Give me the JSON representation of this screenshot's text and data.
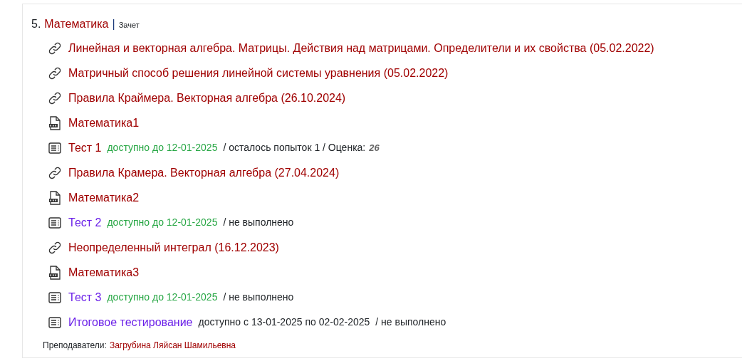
{
  "course": {
    "number": "5.",
    "title": "Математика",
    "separator": "|",
    "assessment": "Зачет"
  },
  "items": [
    {
      "kind": "link",
      "title": "Линейная и векторная алгебра. Матрицы. Действия над матрицами. Определители и их свойства (05.02.2022)",
      "visited": false
    },
    {
      "kind": "link",
      "title": "Матричный способ решения линейной системы уравнения (05.02.2022)",
      "visited": false
    },
    {
      "kind": "link",
      "title": "Правила Краймера. Векторная алгебра (26.10.2024)",
      "visited": false
    },
    {
      "kind": "pdf",
      "title": "Математика1",
      "visited": false
    },
    {
      "kind": "test",
      "title": "Тест 1",
      "visited": false,
      "availability": {
        "text": "доступно до 12-01-2025",
        "color": "#28a745"
      },
      "status": "/ осталось попыток 1 / Оценка:",
      "grade": "26"
    },
    {
      "kind": "link",
      "title": "Правила Крамера. Векторная алгебра (27.04.2024)",
      "visited": false
    },
    {
      "kind": "pdf",
      "title": "Математика2",
      "visited": false
    },
    {
      "kind": "test",
      "title": "Тест 2",
      "visited": true,
      "availability": {
        "text": "доступно до 12-01-2025",
        "color": "#28a745"
      },
      "status": "/ не выполнено"
    },
    {
      "kind": "link",
      "title": "Неопределенный интеграл (16.12.2023)",
      "visited": false
    },
    {
      "kind": "pdf",
      "title": "Математика3",
      "visited": false
    },
    {
      "kind": "test",
      "title": "Тест 3",
      "visited": true,
      "availability": {
        "text": "доступно до 12-01-2025",
        "color": "#28a745"
      },
      "status": "/ не выполнено"
    },
    {
      "kind": "test",
      "title": "Итоговое тестирование",
      "visited": true,
      "availability": {
        "text": "доступно с 13-01-2025 по 02-02-2025",
        "color": "#212529"
      },
      "status": "/ не выполнено"
    }
  ],
  "teachers": {
    "label": "Преподаватели:",
    "name": "Загрубина Ляйсан Шамильевна"
  }
}
